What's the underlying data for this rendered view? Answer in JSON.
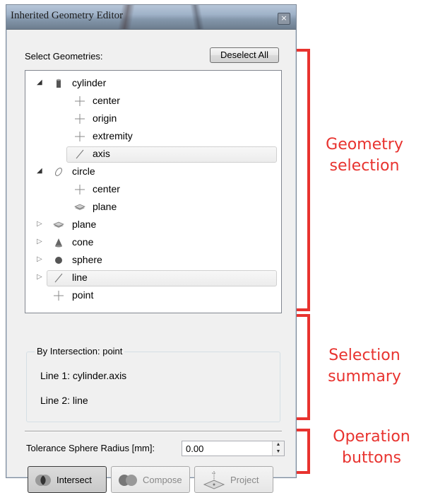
{
  "window": {
    "title": "Inherited Geometry Editor",
    "close_glyph": "×"
  },
  "select": {
    "label": "Select Geometries:",
    "deselect_all": "Deselect All"
  },
  "tree": [
    {
      "label": "cylinder",
      "icon": "cylinder-icon",
      "expanded": true,
      "level": 0
    },
    {
      "label": "center",
      "icon": "point-icon",
      "level": 1
    },
    {
      "label": "origin",
      "icon": "point-icon",
      "level": 1
    },
    {
      "label": "extremity",
      "icon": "point-icon",
      "level": 1
    },
    {
      "label": "axis",
      "icon": "line-icon",
      "level": 1,
      "highlighted": true
    },
    {
      "label": "circle",
      "icon": "circle-icon",
      "expanded": true,
      "level": 0
    },
    {
      "label": "center",
      "icon": "point-icon",
      "level": 1
    },
    {
      "label": "plane",
      "icon": "plane-icon",
      "level": 1
    },
    {
      "label": "plane",
      "icon": "plane-icon",
      "expanded": false,
      "level": 0
    },
    {
      "label": "cone",
      "icon": "cone-icon",
      "expanded": false,
      "level": 0
    },
    {
      "label": "sphere",
      "icon": "sphere-icon",
      "expanded": false,
      "level": 0
    },
    {
      "label": "line",
      "icon": "line-icon",
      "expanded": false,
      "level": 0,
      "highlighted": true
    },
    {
      "label": "point",
      "icon": "point-icon",
      "level": 0
    }
  ],
  "summary": {
    "group_title": "By Intersection: point",
    "line1": "Line 1:  cylinder.axis",
    "line2": "Line 2:  line"
  },
  "tolerance": {
    "label": "Tolerance Sphere Radius [mm]:",
    "value": "0.00"
  },
  "operations": {
    "intersect": "Intersect",
    "compose": "Compose",
    "project": "Project"
  },
  "annotations": {
    "color": "#e8332f",
    "geometry_selection": [
      "Geometry",
      "selection"
    ],
    "selection_summary": [
      "Selection",
      "summary"
    ],
    "operation_buttons": [
      "Operation",
      "buttons"
    ]
  }
}
